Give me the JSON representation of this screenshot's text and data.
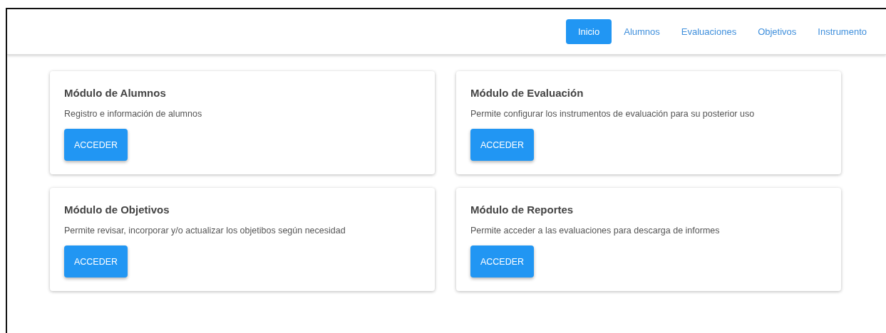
{
  "nav": [
    {
      "label": "Inicio",
      "selected": true
    },
    {
      "label": "Alumnos",
      "selected": false
    },
    {
      "label": "Evaluaciones",
      "selected": false
    },
    {
      "label": "Objetivos",
      "selected": false
    },
    {
      "label": "Instrumento",
      "selected": false
    }
  ],
  "modules": [
    {
      "title": "Módulo de Alumnos",
      "description": "Registro e información de alumnos",
      "button": "ACCEDER"
    },
    {
      "title": "Módulo de Evaluación",
      "description": "Permite configurar los instrumentos de evaluación para su posterior uso",
      "button": "ACCEDER"
    },
    {
      "title": "Módulo de Objetivos",
      "description": "Permite revisar, incorporar y/o actualizar los objetibos según necesidad",
      "button": "ACCEDER"
    },
    {
      "title": "Módulo de Reportes",
      "description": "Permite acceder a las evaluaciones para descarga de informes",
      "button": "ACCEDER"
    }
  ]
}
